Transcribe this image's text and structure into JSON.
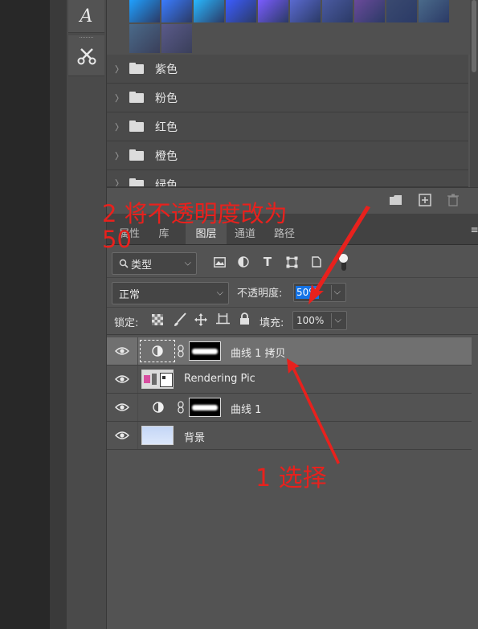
{
  "gradients": {
    "row1": [
      "#1fa0ff",
      "#3a7cff",
      "#28b8ff",
      "#3c5cff",
      "#7a5cff",
      "#5a6ad0",
      "#4a5aa0",
      "#6a4a9a",
      "#3a4a70",
      "#4a6a8a"
    ],
    "row2": [
      "#4a6a8a",
      "#5a5a8a"
    ]
  },
  "folders": [
    {
      "label": "紫色"
    },
    {
      "label": "粉色"
    },
    {
      "label": "红色"
    },
    {
      "label": "橙色"
    },
    {
      "label": "绿色"
    }
  ],
  "tabs": [
    {
      "label": "属性"
    },
    {
      "label": "库"
    },
    {
      "label": "图层"
    },
    {
      "label": "通道"
    },
    {
      "label": "路径"
    }
  ],
  "filter": {
    "kind_label": "类型"
  },
  "blend": {
    "mode": "正常",
    "opacity_label": "不透明度:",
    "opacity_value": "50%"
  },
  "lock": {
    "label": "锁定:",
    "fill_label": "填充:",
    "fill_value": "100%"
  },
  "layers": [
    {
      "name": "曲线 1 拷贝"
    },
    {
      "name": "Rendering Pic"
    },
    {
      "name": "曲线 1"
    },
    {
      "name": "背景"
    }
  ],
  "annotations": {
    "step2": "2 将不透明度改为 50",
    "step1": "1 选择"
  },
  "colors": {
    "annotation": "#e8211d",
    "selection": "#1473e6"
  }
}
